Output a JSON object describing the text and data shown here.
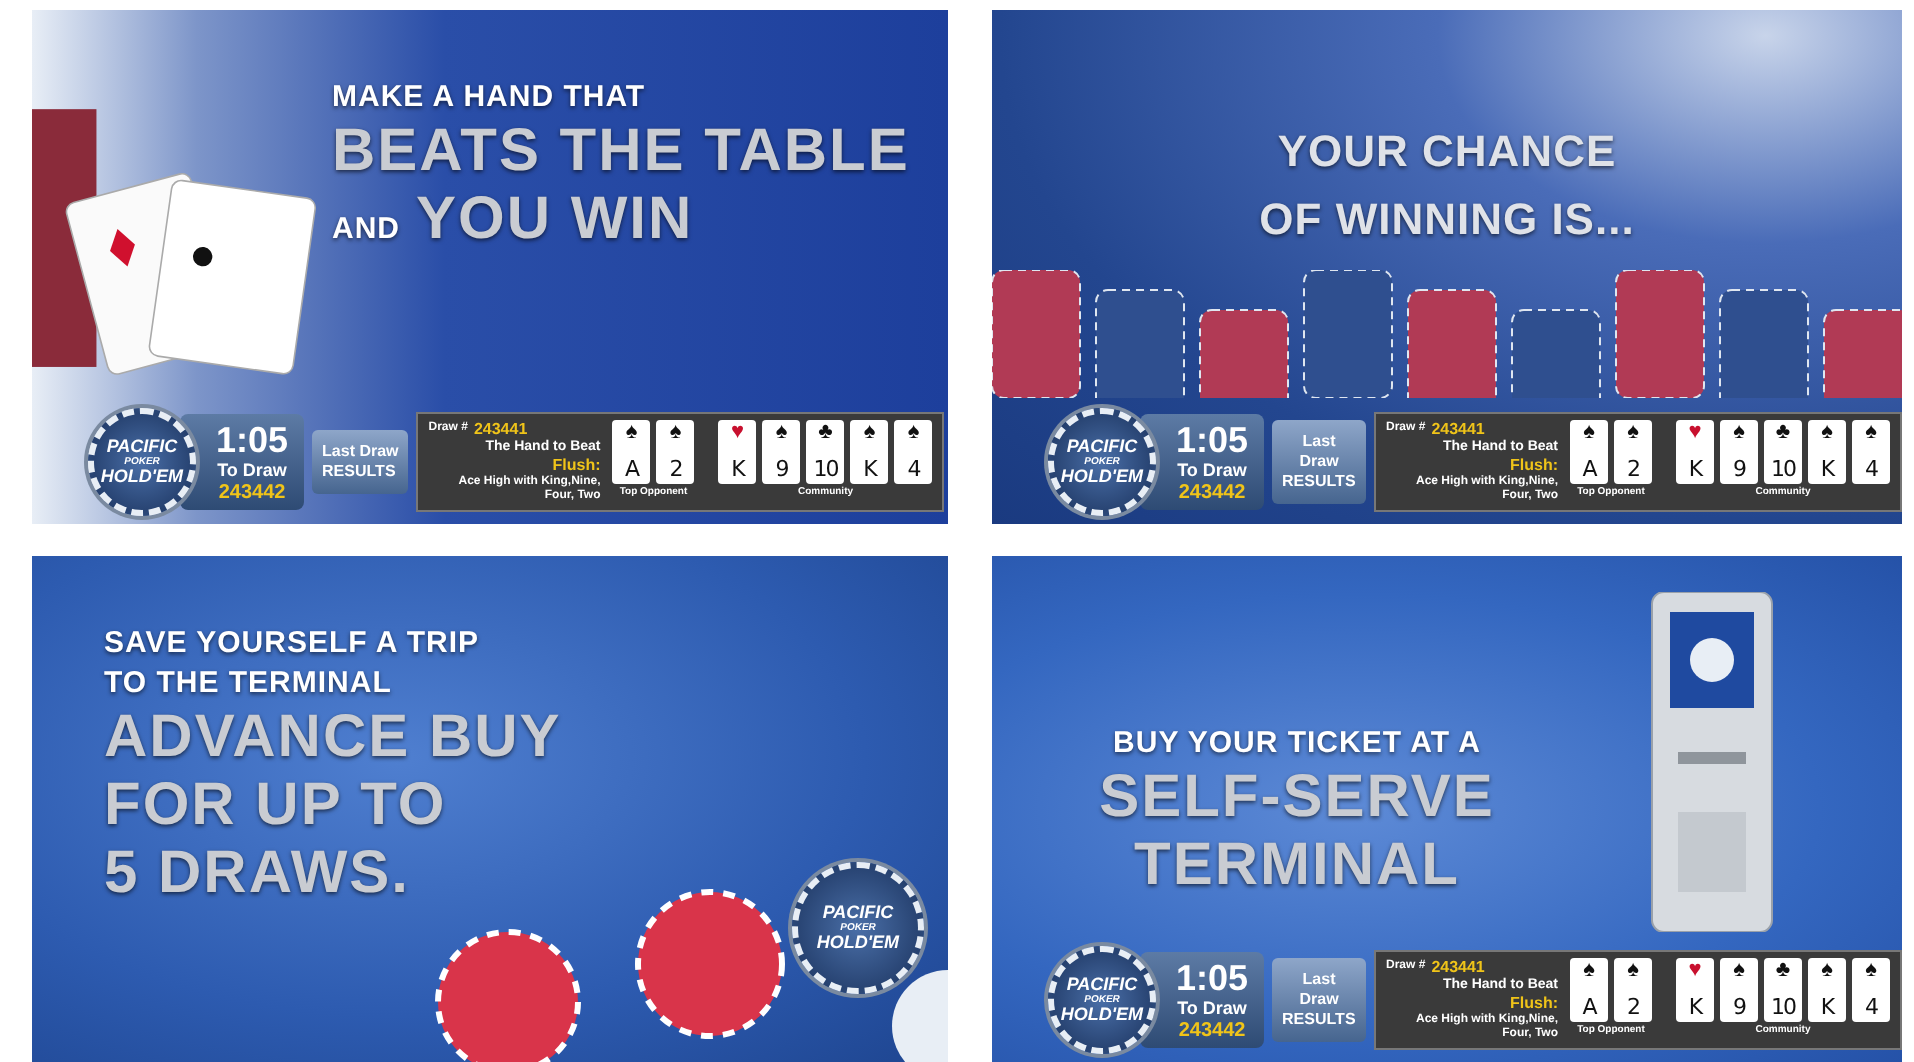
{
  "panels": [
    {
      "kind": "cards",
      "headline": [
        [
          {
            "text": "MAKE A HAND THAT",
            "kind": "small"
          }
        ],
        [
          {
            "text": "BEATS THE TABLE",
            "kind": "large"
          }
        ],
        [
          {
            "text": "AND",
            "kind": "small"
          },
          {
            "text": "YOU WIN",
            "kind": "large"
          }
        ]
      ],
      "ticker": {
        "logo": [
          "PACIFIC",
          "POKER",
          "HOLD'EM"
        ],
        "time": "1:05",
        "to_draw": "To Draw",
        "next_draw": "243442",
        "button": [
          "Last Draw",
          "RESULTS"
        ],
        "draw_label": "Draw #",
        "draw_number": "243441",
        "hand_title": "The Hand to Beat",
        "hand_name": "Flush:",
        "hand_detail": "Ace High with King,Nine, Four, Two",
        "opponent_label": "Top Opponent",
        "community_label": "Community",
        "opponent": [
          {
            "rank": "A",
            "suit": "♠",
            "color": "#111111"
          },
          {
            "rank": "2",
            "suit": "♠",
            "color": "#111111"
          }
        ],
        "community": [
          {
            "rank": "K",
            "suit": "♥",
            "color": "#c8102e"
          },
          {
            "rank": "9",
            "suit": "♠",
            "color": "#111111"
          },
          {
            "rank": "10",
            "suit": "♣",
            "color": "#111111"
          },
          {
            "rank": "K",
            "suit": "♠",
            "color": "#111111"
          },
          {
            "rank": "4",
            "suit": "♠",
            "color": "#111111"
          }
        ]
      }
    },
    {
      "kind": "chips",
      "headline": [
        [
          {
            "text": "YOUR CHANCE",
            "kind": "medium"
          }
        ],
        [
          {
            "text": "OF WINNING IS...",
            "kind": "medium"
          }
        ]
      ],
      "ticker": {
        "logo": [
          "PACIFIC",
          "POKER",
          "HOLD'EM"
        ],
        "time": "1:05",
        "to_draw": "To Draw",
        "next_draw": "243442",
        "button": [
          "Last Draw",
          "RESULTS"
        ],
        "draw_label": "Draw #",
        "draw_number": "243441",
        "hand_title": "The Hand to Beat",
        "hand_name": "Flush:",
        "hand_detail": "Ace High with King,Nine, Four, Two",
        "opponent_label": "Top Opponent",
        "community_label": "Community",
        "opponent": [
          {
            "rank": "A",
            "suit": "♠",
            "color": "#111111"
          },
          {
            "rank": "2",
            "suit": "♠",
            "color": "#111111"
          }
        ],
        "community": [
          {
            "rank": "K",
            "suit": "♥",
            "color": "#c8102e"
          },
          {
            "rank": "9",
            "suit": "♠",
            "color": "#111111"
          },
          {
            "rank": "10",
            "suit": "♣",
            "color": "#111111"
          },
          {
            "rank": "K",
            "suit": "♠",
            "color": "#111111"
          },
          {
            "rank": "4",
            "suit": "♠",
            "color": "#111111"
          }
        ]
      }
    },
    {
      "kind": "felt",
      "logo": [
        "PACIFIC",
        "POKER",
        "HOLD'EM"
      ],
      "headline": [
        [
          {
            "text": "SAVE YOURSELF A TRIP",
            "kind": "small"
          }
        ],
        [
          {
            "text": "TO THE TERMINAL",
            "kind": "small"
          }
        ],
        [
          {
            "text": "ADVANCE BUY",
            "kind": "large"
          }
        ],
        [
          {
            "text": "FOR UP TO",
            "kind": "large"
          }
        ],
        [
          {
            "text": "5 DRAWS.",
            "kind": "large"
          }
        ]
      ]
    },
    {
      "kind": "kiosk",
      "headline": [
        [
          {
            "text": "BUY YOUR TICKET AT A",
            "kind": "small"
          }
        ],
        [
          {
            "text": "SELF-SERVE",
            "kind": "large"
          }
        ],
        [
          {
            "text": "TERMINAL",
            "kind": "large"
          }
        ]
      ],
      "ticker": {
        "logo": [
          "PACIFIC",
          "POKER",
          "HOLD'EM"
        ],
        "time": "1:05",
        "to_draw": "To Draw",
        "next_draw": "243442",
        "button": [
          "Last Draw",
          "RESULTS"
        ],
        "draw_label": "Draw #",
        "draw_number": "243441",
        "hand_title": "The Hand to Beat",
        "hand_name": "Flush:",
        "hand_detail": "Ace High with King,Nine, Four, Two",
        "opponent_label": "Top Opponent",
        "community_label": "Community",
        "opponent": [
          {
            "rank": "A",
            "suit": "♠",
            "color": "#111111"
          },
          {
            "rank": "2",
            "suit": "♠",
            "color": "#111111"
          }
        ],
        "community": [
          {
            "rank": "K",
            "suit": "♥",
            "color": "#c8102e"
          },
          {
            "rank": "9",
            "suit": "♠",
            "color": "#111111"
          },
          {
            "rank": "10",
            "suit": "♣",
            "color": "#111111"
          },
          {
            "rank": "K",
            "suit": "♠",
            "color": "#111111"
          },
          {
            "rank": "4",
            "suit": "♠",
            "color": "#111111"
          }
        ]
      }
    }
  ]
}
